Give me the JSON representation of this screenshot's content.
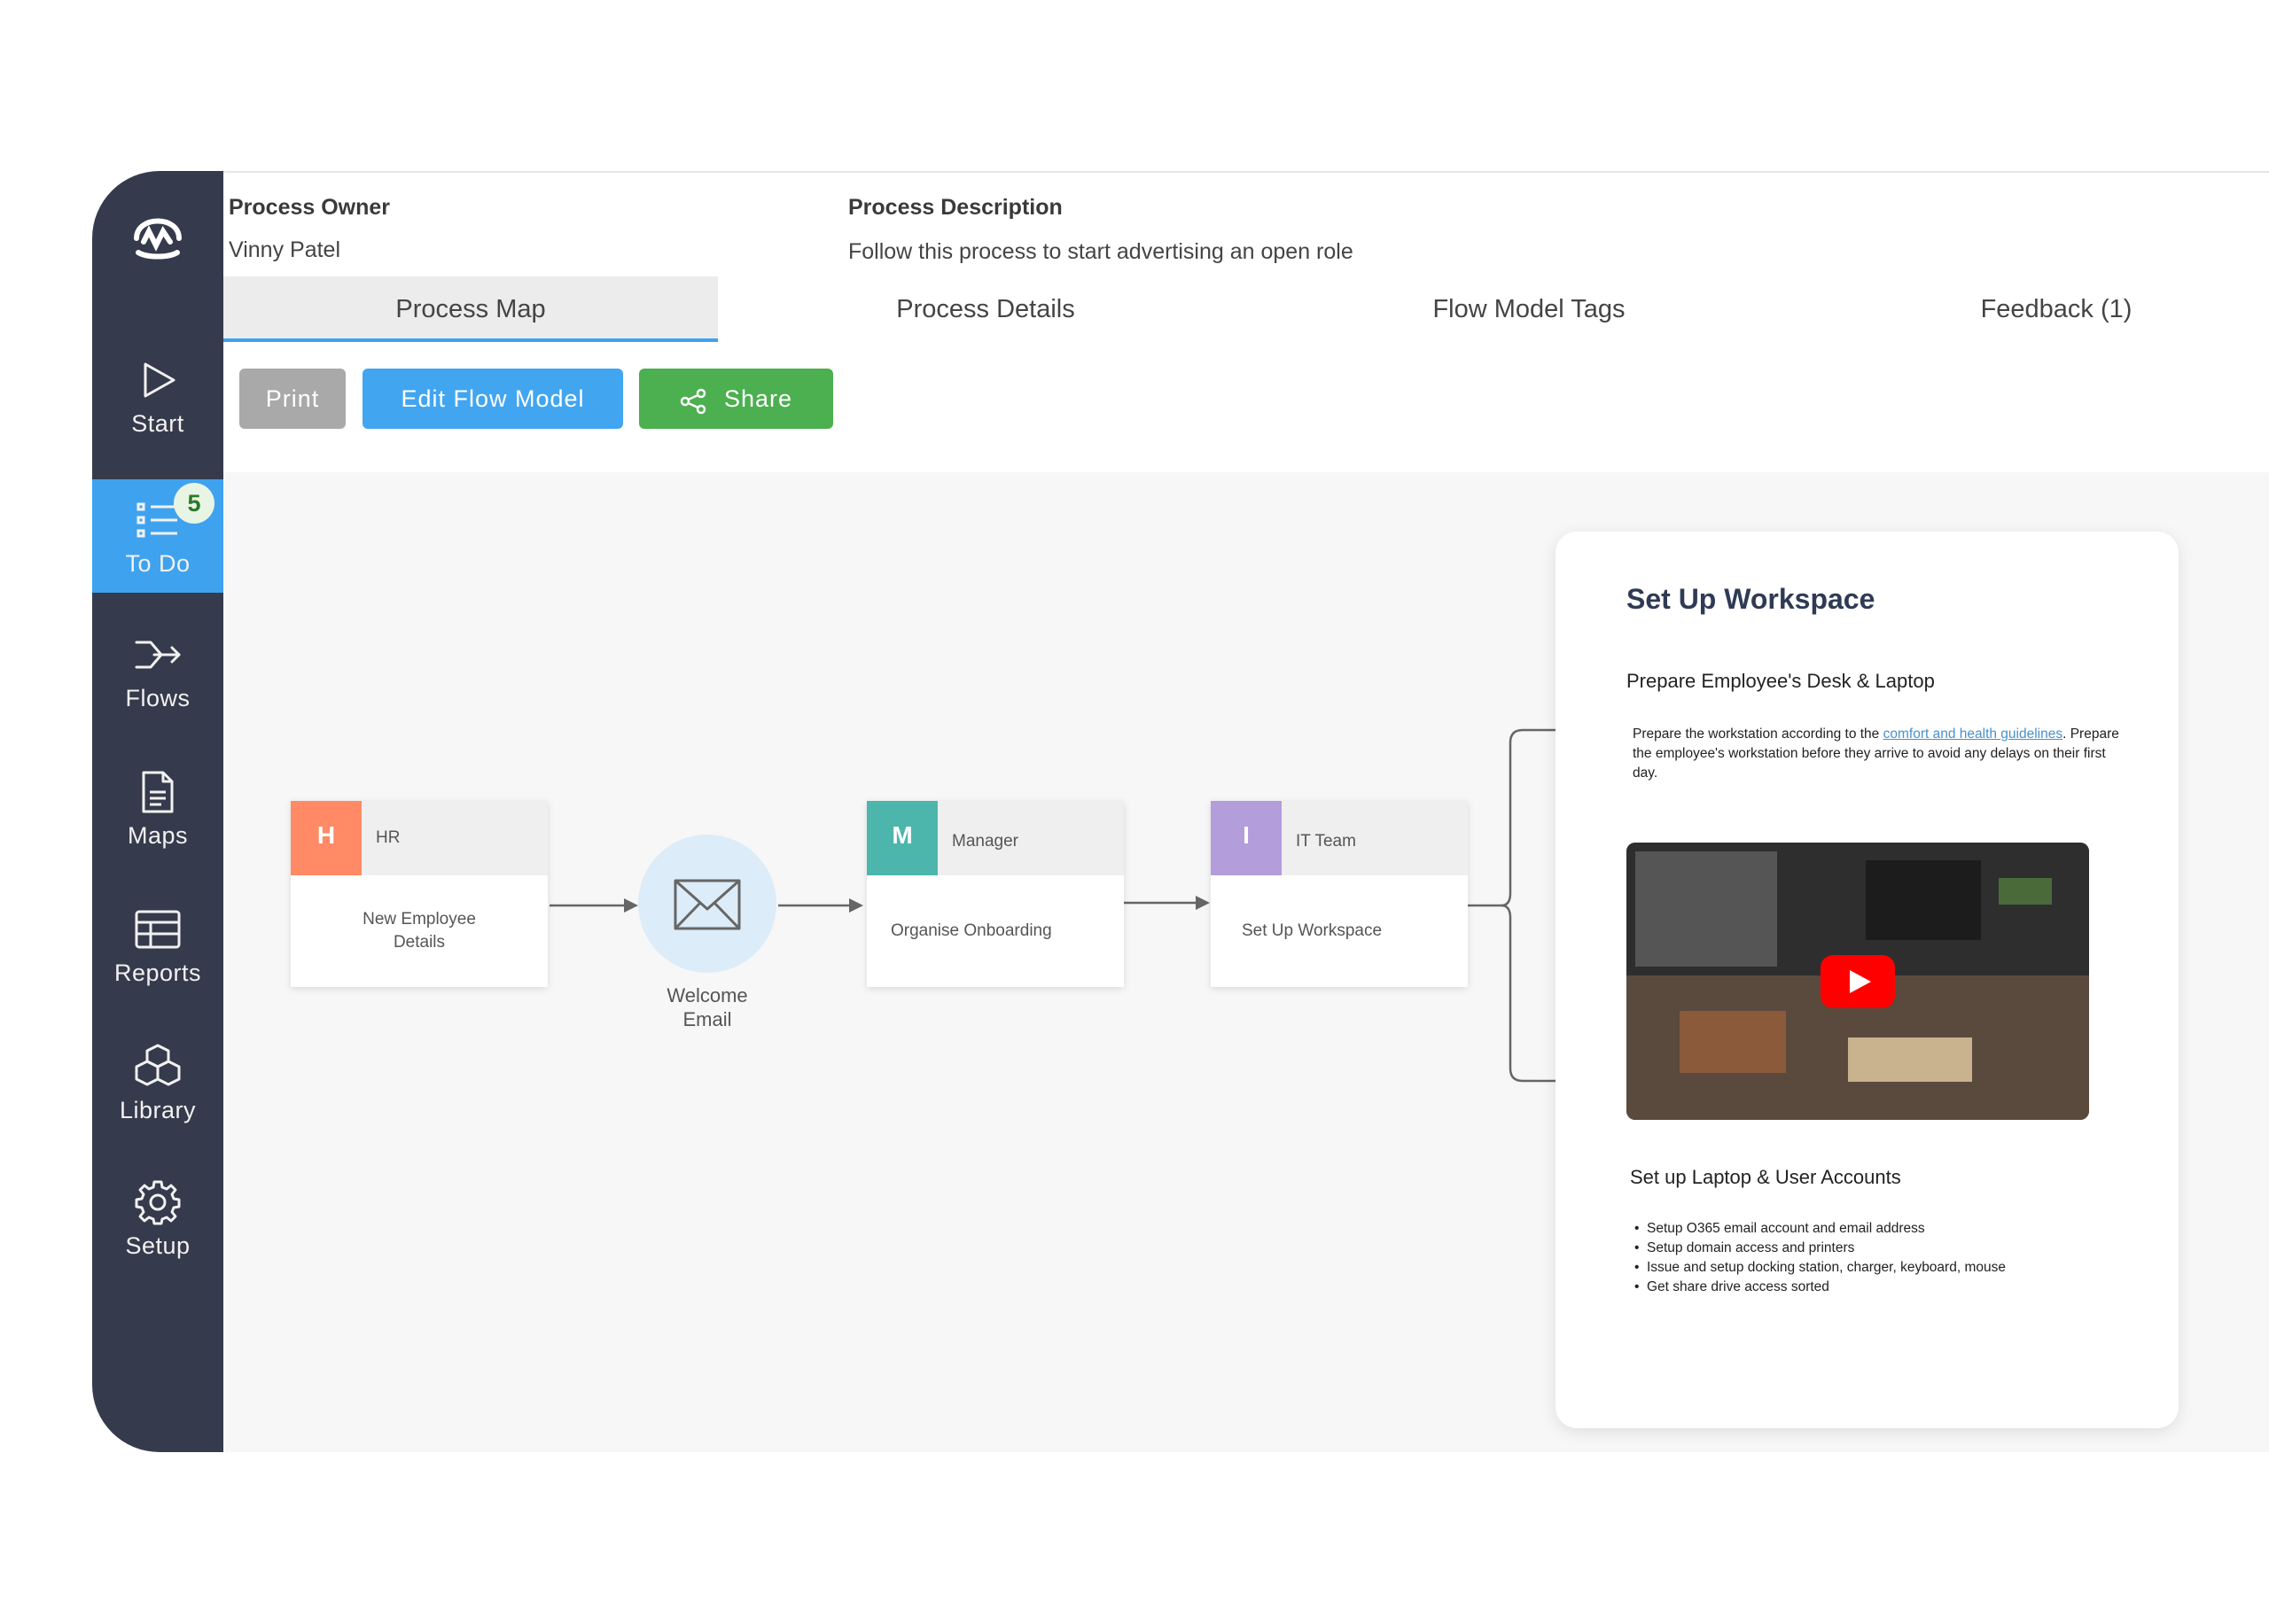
{
  "sidebar": {
    "items": [
      {
        "label": "Start",
        "icon": "play-icon"
      },
      {
        "label": "To Do",
        "icon": "list-icon",
        "badge": "5",
        "active": true
      },
      {
        "label": "Flows",
        "icon": "flows-icon"
      },
      {
        "label": "Maps",
        "icon": "document-icon"
      },
      {
        "label": "Reports",
        "icon": "table-icon"
      },
      {
        "label": "Library",
        "icon": "cubes-icon"
      },
      {
        "label": "Setup",
        "icon": "gear-icon"
      }
    ]
  },
  "header": {
    "owner_label": "Process Owner",
    "owner_value": "Vinny Patel",
    "description_label": "Process Description",
    "description_value": "Follow this process to start advertising an open role"
  },
  "tabs": [
    {
      "label": "Process Map",
      "active": true
    },
    {
      "label": "Process Details"
    },
    {
      "label": "Flow Model Tags"
    },
    {
      "label": "Feedback (1)"
    }
  ],
  "toolbar": {
    "print_label": "Print",
    "edit_label": "Edit Flow Model",
    "share_label": "Share"
  },
  "flow": {
    "nodes": [
      {
        "initial": "H",
        "role": "HR",
        "task": "New Employee Details",
        "color": "#ff8a65"
      },
      {
        "initial": "M",
        "role": "Manager",
        "task": "Organise Onboarding",
        "color": "#4db6ac"
      },
      {
        "initial": "I",
        "role": "IT Team",
        "task": "Set Up Workspace",
        "color": "#b39ddb"
      }
    ],
    "email_label": "Welcome Email"
  },
  "detail": {
    "title": "Set Up Workspace",
    "section1_title": "Prepare Employee's Desk & Laptop",
    "para_prefix": "Prepare the workstation according to the ",
    "para_link": "comfort and health guidelines",
    "para_suffix": ". Prepare the employee's workstation before they arrive to avoid any delays on their first day.",
    "section2_title": "Set up Laptop & User Accounts",
    "list": [
      "Setup O365 email account and email address",
      "Setup domain access and printers",
      "Issue and setup docking station, charger, keyboard, mouse",
      "Get share drive access sorted"
    ]
  },
  "colors": {
    "sidebar_bg": "#353a4c",
    "accent_blue": "#3fa2ef",
    "share_green": "#4caf50",
    "print_gray": "#a9a9a9"
  }
}
